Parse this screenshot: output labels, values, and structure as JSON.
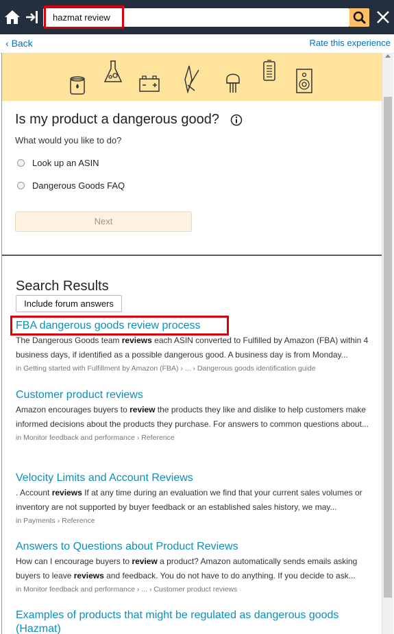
{
  "search": {
    "value": "hazmat review"
  },
  "nav": {
    "back_label": "Back",
    "rate_label": "Rate this experience"
  },
  "question": {
    "title": "Is my product a dangerous good?",
    "prompt": "What would you like to do?",
    "options": [
      "Look up an ASIN",
      "Dangerous Goods FAQ"
    ],
    "next_label": "Next"
  },
  "banner": {
    "icons": [
      "oil-can-icon",
      "flask-icon",
      "battery-icon",
      "pocket-knife-icon",
      "bulb-icon",
      "power-bank-icon",
      "speaker-icon"
    ]
  },
  "results": {
    "title": "Search Results",
    "forum_label": "Include forum answers",
    "items": [
      {
        "title": "FBA dangerous goods review process",
        "snippet": [
          [
            "The Dangerous Goods team ",
            false
          ],
          [
            "reviews",
            true
          ],
          [
            " each ASIN converted to Fulfilled by Amazon (FBA) within 4 business days, if identified as a possible dangerous good. A business day is from Monday...",
            false
          ]
        ],
        "crumb": "in Getting started with Fulfillment by Amazon (FBA) › ... › Dangerous goods identification guide"
      },
      {
        "title": "Customer product reviews",
        "snippet": [
          [
            "Amazon encourages buyers to ",
            false
          ],
          [
            "review",
            true
          ],
          [
            " the products they like and dislike to help customers make informed decisions about the products they purchase. For answers to common questions about...",
            false
          ]
        ],
        "crumb": "in Monitor feedback and performance › Reference"
      },
      {
        "title": "Velocity Limits and Account Reviews",
        "snippet": [
          [
            ". Account ",
            false
          ],
          [
            "reviews",
            true
          ],
          [
            " If at any time during an evaluation we find that your current sales volumes or inventory are not supported by buyer feedback or an established sales history, we may...",
            false
          ]
        ],
        "crumb": "in Payments › Reference"
      },
      {
        "title": "Answers to Questions about Product Reviews",
        "snippet": [
          [
            "How can I encourage buyers to ",
            false
          ],
          [
            "review",
            true
          ],
          [
            " a product? Amazon automatically sends emails asking buyers to leave ",
            false
          ],
          [
            "reviews",
            true
          ],
          [
            " and feedback. You do not have to do anything. If you decide to ask...",
            false
          ]
        ],
        "crumb": "in Monitor feedback and performance › ... › Customer product reviews"
      },
      {
        "title": "Examples of products that might be regulated as dangerous goods (Hazmat)",
        "snippet": [],
        "crumb": ""
      }
    ]
  },
  "colors": {
    "topbar": "#232f3e",
    "search_button": "#febd69",
    "link": "#0a8fbb",
    "banner": "#fde39c",
    "highlight": "#d9000d"
  }
}
